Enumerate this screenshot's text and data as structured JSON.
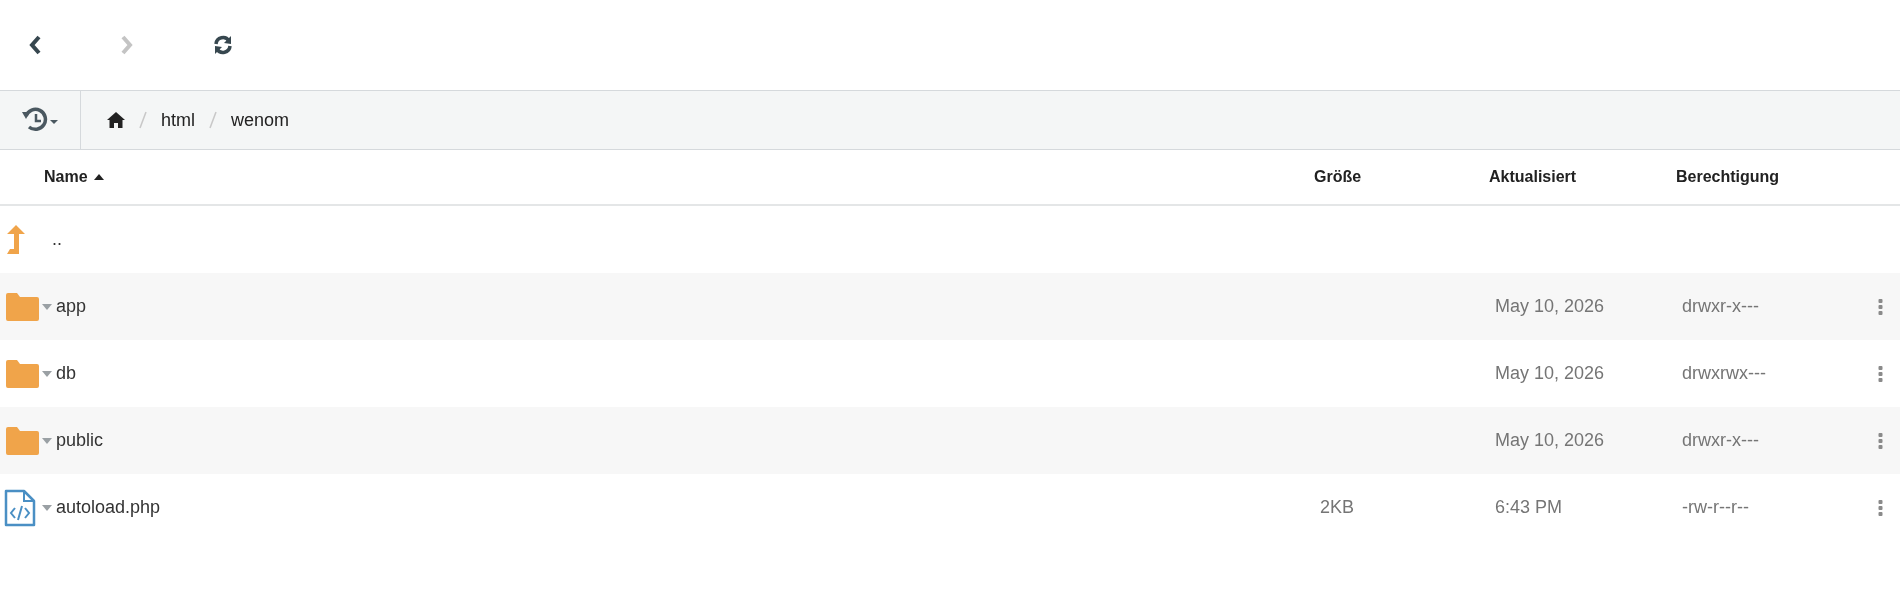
{
  "toolbar": [
    {
      "kind": "back",
      "disabled": false
    },
    {
      "kind": "forward",
      "disabled": true
    },
    {
      "kind": "refresh",
      "disabled": false
    }
  ],
  "breadcrumb": {
    "items": [
      "html",
      "wenom"
    ]
  },
  "table": {
    "columns": [
      {
        "label": "Name",
        "sorted": true
      },
      {
        "label": "Größe",
        "sorted": false
      },
      {
        "label": "Aktualisiert",
        "sorted": false
      },
      {
        "label": "Berechtigung",
        "sorted": false
      }
    ],
    "rows": [
      {
        "kind": "parent",
        "name": ".."
      },
      {
        "kind": "folder",
        "name": "app",
        "updated": "May 10, 2026",
        "permissions": "drwxr-x---"
      },
      {
        "kind": "folder",
        "name": "db",
        "updated": "May 10, 2026",
        "permissions": "drwxrwx---"
      },
      {
        "kind": "folder",
        "name": "public",
        "updated": "May 10, 2026",
        "permissions": "drwxr-x---"
      },
      {
        "kind": "file",
        "name": "autoload.php",
        "size": "2KB",
        "updated": "6:43 PM",
        "permissions": "-rw-r--r--"
      }
    ]
  }
}
